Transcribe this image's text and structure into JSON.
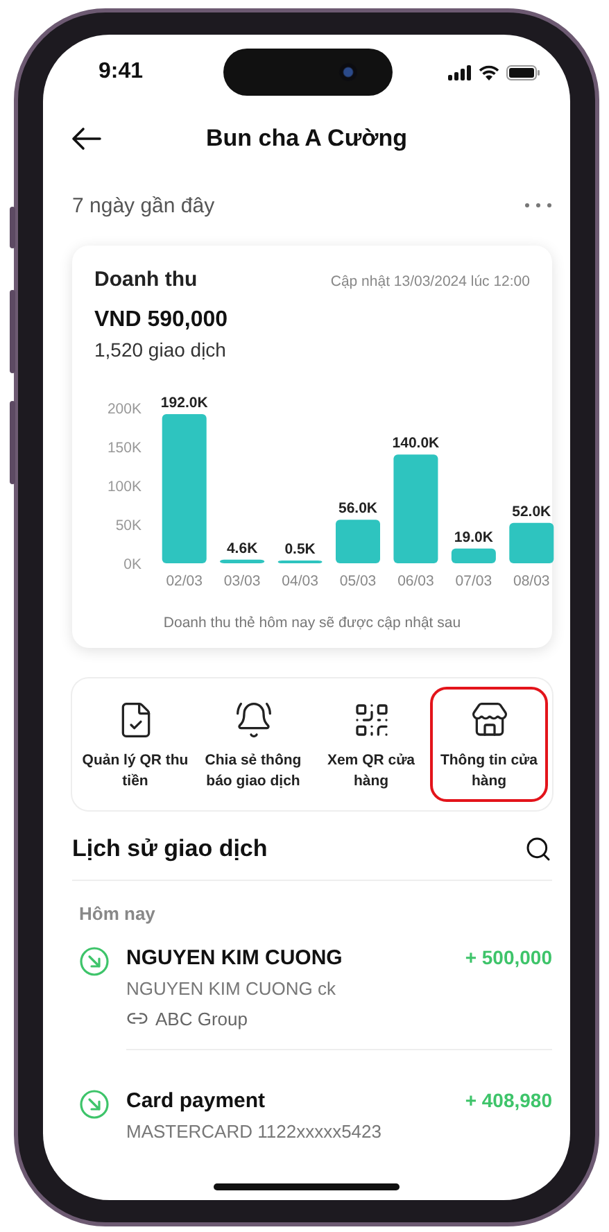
{
  "status_bar": {
    "time": "9:41"
  },
  "header": {
    "title": "Bun cha A Cường"
  },
  "period": {
    "label": "7 ngày gần đây"
  },
  "revenue": {
    "title": "Doanh thu",
    "updated": "Cập nhật 13/03/2024 lúc 12:00",
    "total": "VND 590,000",
    "transactions": "1,520 giao dịch",
    "chart_data": {
      "type": "bar",
      "categories": [
        "02/03",
        "03/03",
        "04/03",
        "05/03",
        "06/03",
        "07/03",
        "08/03"
      ],
      "values": [
        192000,
        4600,
        500,
        56000,
        140000,
        19000,
        52000
      ],
      "ylim": [
        0,
        200000
      ],
      "yticks": [
        {
          "value": 0,
          "label": "0K"
        },
        {
          "value": 50000,
          "label": "50K"
        },
        {
          "value": 100000,
          "label": "100K"
        },
        {
          "value": 150000,
          "label": "150K"
        },
        {
          "value": 200000,
          "label": "200K"
        }
      ],
      "value_labels": [
        "192.0K",
        "4.6K",
        "0.5K",
        "56.0K",
        "140.0K",
        "19.0K",
        "52.0K"
      ]
    },
    "note": "Doanh thu thẻ hôm nay sẽ được cập nhật sau"
  },
  "actions": [
    {
      "kind": "document",
      "label": "Quản lý QR thu tiền",
      "highlighted": false
    },
    {
      "kind": "bell",
      "label": "Chia sẻ thông báo giao dịch",
      "highlighted": false
    },
    {
      "kind": "qr",
      "label": "Xem QR cửa hàng",
      "highlighted": false
    },
    {
      "kind": "store",
      "label": "Thông tin cửa hàng",
      "highlighted": true
    }
  ],
  "history": {
    "title": "Lịch sử giao dịch",
    "sections": [
      {
        "label": "Hôm nay",
        "items": [
          {
            "name": "NGUYEN KIM CUONG",
            "description": "NGUYEN KIM CUONG ck",
            "group": "ABC Group",
            "amount": "+ 500,000"
          },
          {
            "name": "Card payment",
            "description": "MASTERCARD 1122xxxxx5423",
            "amount": "+ 408,980"
          }
        ]
      }
    ]
  }
}
